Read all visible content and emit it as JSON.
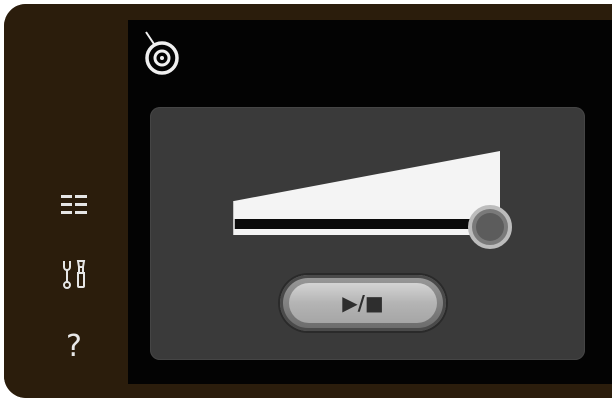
{
  "sidebar": {
    "items": [
      {
        "name": "menu-list-icon"
      },
      {
        "name": "tools-icon"
      },
      {
        "name": "help-icon",
        "label": "?"
      }
    ]
  },
  "header": {
    "icon": "thread-spool-icon"
  },
  "control": {
    "slider_level": 1.0,
    "play_stop_label": "▶/■"
  },
  "colors": {
    "frame": "#2b1d0c",
    "screen": "#030303",
    "panel": "#3a3a3a",
    "ramp": "#f4f4f4",
    "knob": "#6e6e6e"
  }
}
